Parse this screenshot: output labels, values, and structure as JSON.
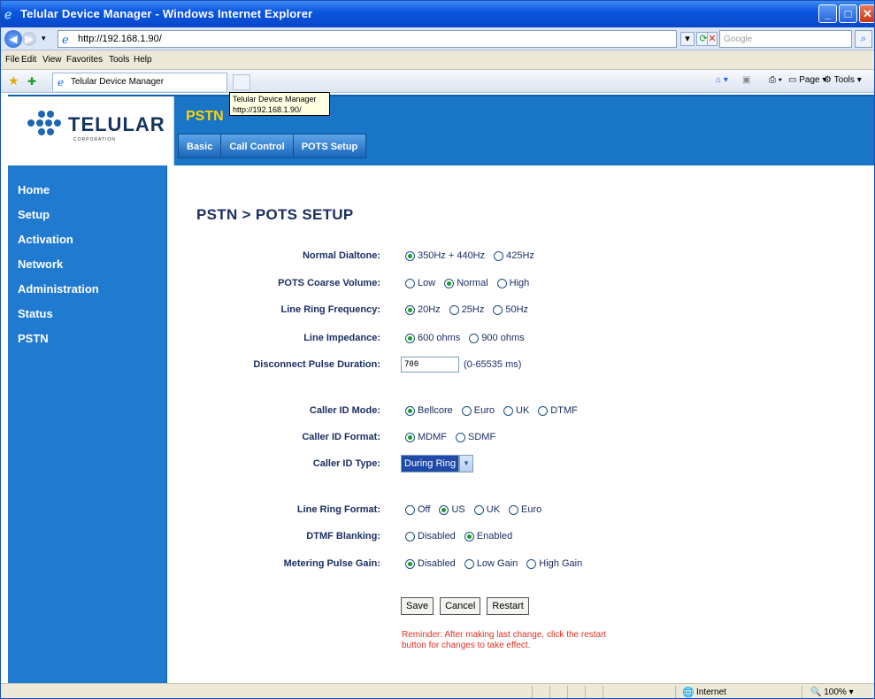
{
  "window": {
    "title": "Telular Device Manager - Windows Internet Explorer"
  },
  "addressbar": {
    "url": "http://192.168.1.90/",
    "search_placeholder": "Google"
  },
  "menubar": {
    "items": [
      "File",
      "Edit",
      "View",
      "Favorites",
      "Tools",
      "Help"
    ]
  },
  "tabbar": {
    "tab_title": "Telular Device Manager",
    "page_label": "Page",
    "tools_label": "Tools"
  },
  "tooltip": {
    "title": "Telular Device Manager",
    "url": "http://192.168.1.90/"
  },
  "header": {
    "logo": {
      "brand": "TELULAR",
      "sub": "CORPORATION"
    },
    "section_title": "PSTN",
    "tabs": [
      "Basic",
      "Call Control",
      "POTS Setup"
    ]
  },
  "sidebar": {
    "items": [
      "Home",
      "Setup",
      "Activation",
      "Network",
      "Administration",
      "Status",
      "PSTN"
    ]
  },
  "page": {
    "title": "PSTN > POTS SETUP",
    "fields": {
      "normal_dialtone": {
        "label": "Normal Dialtone:",
        "options": [
          "350Hz + 440Hz",
          "425Hz"
        ],
        "selected": 0
      },
      "pots_coarse_volume": {
        "label": "POTS Coarse Volume:",
        "options": [
          "Low",
          "Normal",
          "High"
        ],
        "selected": 1
      },
      "line_ring_frequency": {
        "label": "Line Ring Frequency:",
        "options": [
          "20Hz",
          "25Hz",
          "50Hz"
        ],
        "selected": 0
      },
      "line_impedance": {
        "label": "Line Impedance:",
        "options": [
          "600 ohms",
          "900 ohms"
        ],
        "selected": 0
      },
      "disconnect_pulse_duration": {
        "label": "Disconnect Pulse Duration:",
        "value": "700",
        "hint": "(0-65535 ms)"
      },
      "caller_id_mode": {
        "label": "Caller ID Mode:",
        "options": [
          "Bellcore",
          "Euro",
          "UK",
          "DTMF"
        ],
        "selected": 0
      },
      "caller_id_format": {
        "label": "Caller ID Format:",
        "options": [
          "MDMF",
          "SDMF"
        ],
        "selected": 0
      },
      "caller_id_type": {
        "label": "Caller  ID Type:",
        "value": "During Ring"
      },
      "line_ring_format": {
        "label": "Line Ring Format:",
        "options": [
          "Off",
          "US",
          "UK",
          "Euro"
        ],
        "selected": 1
      },
      "dtmf_blanking": {
        "label": "DTMF Blanking:",
        "options": [
          "Disabled",
          "Enabled"
        ],
        "selected": 1
      },
      "metering_pulse_gain": {
        "label": "Metering Pulse Gain:",
        "options": [
          "Disabled",
          "Low Gain",
          "High Gain"
        ],
        "selected": 0
      }
    },
    "buttons": {
      "save": "Save",
      "cancel": "Cancel",
      "restart": "Restart"
    },
    "reminder": "Reminder: After making last change, click the restart button for changes to take effect."
  },
  "statusbar": {
    "zone": "Internet",
    "zoom": "100%"
  },
  "colors": {
    "accent_blue": "#1f7ad0",
    "title_text": "#1b2f63",
    "section_yellow": "#ffd400",
    "reminder_red": "#e0301f",
    "radio_green": "#1a9b2c"
  }
}
